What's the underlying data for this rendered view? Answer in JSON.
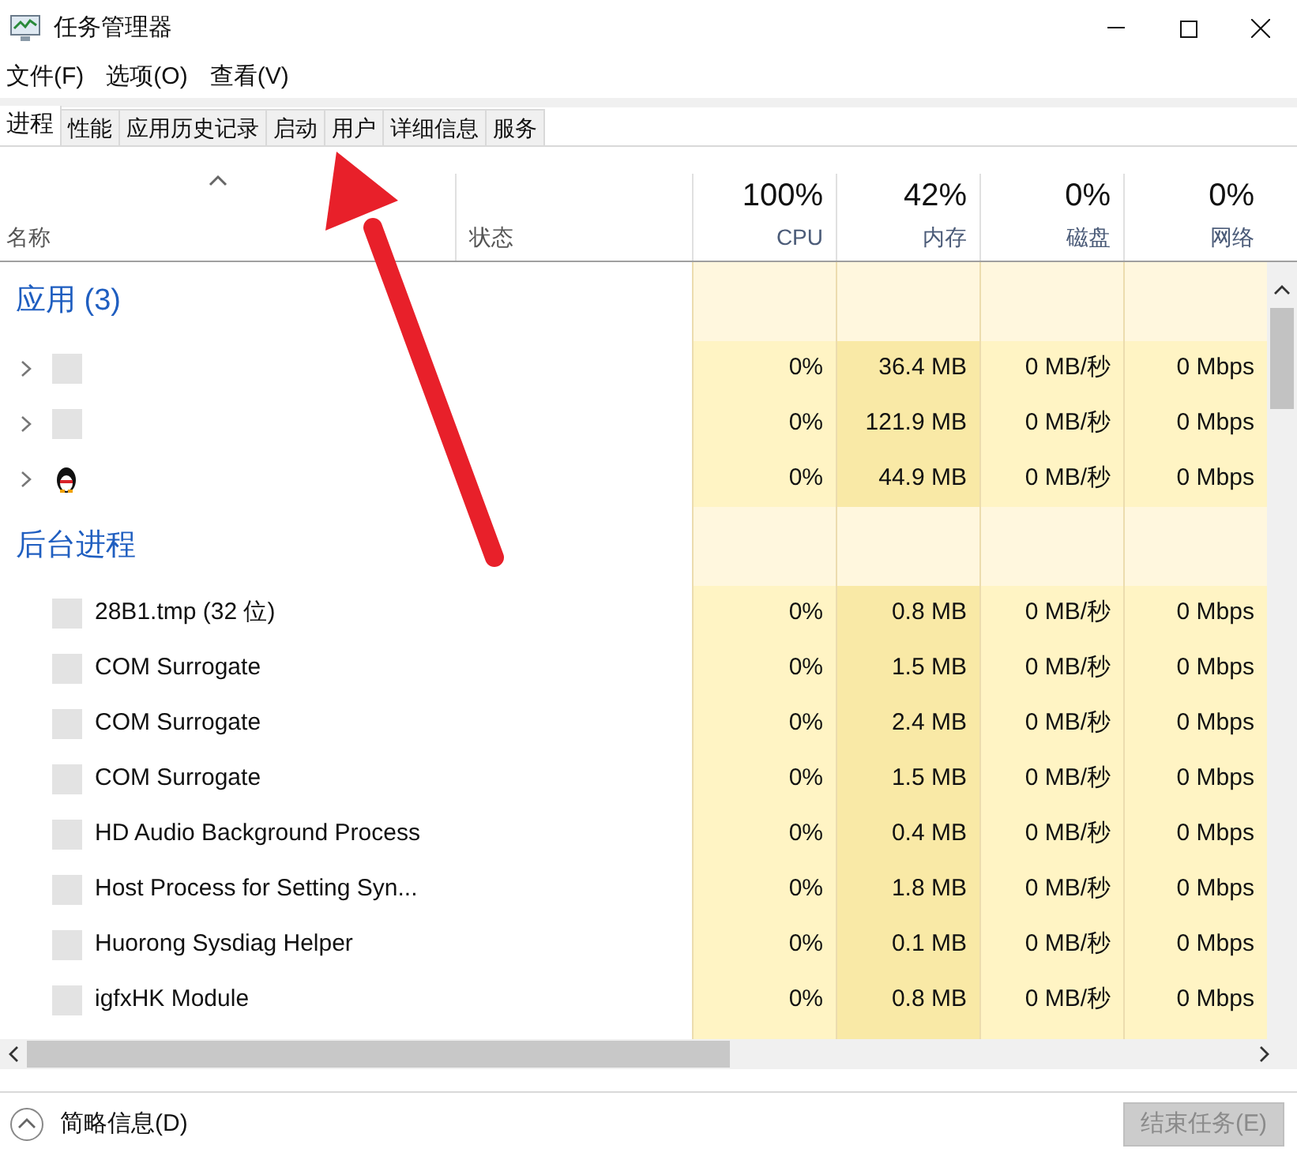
{
  "window": {
    "title": "任务管理器"
  },
  "menu": [
    "文件(F)",
    "选项(O)",
    "查看(V)"
  ],
  "tabs": [
    {
      "label": "进程",
      "selected": true
    },
    {
      "label": "性能",
      "selected": false
    },
    {
      "label": "应用历史记录",
      "selected": false
    },
    {
      "label": "启动",
      "selected": false
    },
    {
      "label": "用户",
      "selected": false
    },
    {
      "label": "详细信息",
      "selected": false
    },
    {
      "label": "服务",
      "selected": false
    }
  ],
  "columns": [
    {
      "label": "名称"
    },
    {
      "label": "状态"
    },
    {
      "label": "CPU",
      "total": "100%"
    },
    {
      "label": "内存",
      "total": "42%"
    },
    {
      "label": "磁盘",
      "total": "0%"
    },
    {
      "label": "网络",
      "total": "0%"
    }
  ],
  "groups": [
    {
      "title": "应用 (3)",
      "rows": [
        {
          "kind": "app",
          "cpu": "0%",
          "memory": "36.4 MB",
          "disk": "0 MB/秒",
          "network": "0 Mbps"
        },
        {
          "kind": "app",
          "cpu": "0%",
          "memory": "121.9 MB",
          "disk": "0 MB/秒",
          "network": "0 Mbps"
        },
        {
          "kind": "penguin_app",
          "cpu": "0%",
          "memory": "44.9 MB",
          "disk": "0 MB/秒",
          "network": "0 Mbps"
        }
      ]
    },
    {
      "title": "后台进程",
      "rows": [
        {
          "kind": "process",
          "name": "28B1.tmp (32 位)",
          "cpu": "0%",
          "memory": "0.8 MB",
          "disk": "0 MB/秒",
          "network": "0 Mbps"
        },
        {
          "kind": "process",
          "name": "COM Surrogate",
          "cpu": "0%",
          "memory": "1.5 MB",
          "disk": "0 MB/秒",
          "network": "0 Mbps"
        },
        {
          "kind": "process",
          "name": "COM Surrogate",
          "cpu": "0%",
          "memory": "2.4 MB",
          "disk": "0 MB/秒",
          "network": "0 Mbps"
        },
        {
          "kind": "process",
          "name": "COM Surrogate",
          "cpu": "0%",
          "memory": "1.5 MB",
          "disk": "0 MB/秒",
          "network": "0 Mbps"
        },
        {
          "kind": "process",
          "name": "HD Audio Background Process",
          "cpu": "0%",
          "memory": "0.4 MB",
          "disk": "0 MB/秒",
          "network": "0 Mbps"
        },
        {
          "kind": "process",
          "name": "Host Process for Setting Syn...",
          "cpu": "0%",
          "memory": "1.8 MB",
          "disk": "0 MB/秒",
          "network": "0 Mbps"
        },
        {
          "kind": "process",
          "name": "Huorong Sysdiag Helper",
          "cpu": "0%",
          "memory": "0.1 MB",
          "disk": "0 MB/秒",
          "network": "0 Mbps"
        },
        {
          "kind": "process",
          "name": "igfxHK Module",
          "cpu": "0%",
          "memory": "0.8 MB",
          "disk": "0 MB/秒",
          "network": "0 Mbps"
        }
      ]
    }
  ],
  "footer": {
    "details_label": "简略信息(D)",
    "end_task": {
      "label": "结束任务(E)",
      "disabled": true
    }
  }
}
